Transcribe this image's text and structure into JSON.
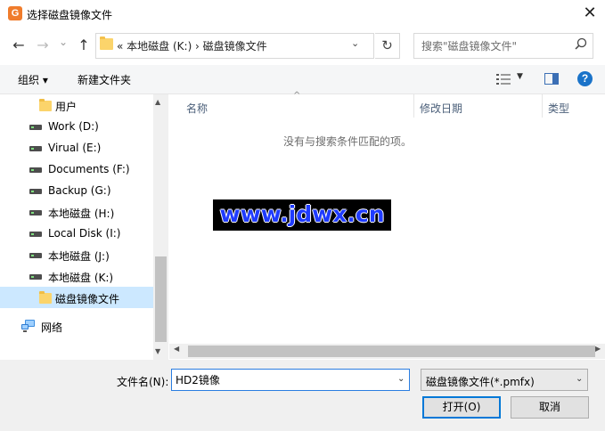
{
  "window": {
    "title": "选择磁盘镜像文件",
    "app_icon_letter": "G",
    "close_glyph": "✕"
  },
  "nav": {
    "back_glyph": "←",
    "forward_glyph": "→",
    "recent_glyph": "⌄",
    "up_glyph": "↑",
    "address_text": "«   本地磁盘 (K:)   ›   磁盘镜像文件",
    "address_chevron": "⌄",
    "refresh_glyph": "↻",
    "search_placeholder": "搜索\"磁盘镜像文件\""
  },
  "toolbar": {
    "organize_label": "组织 ▾",
    "new_folder_label": "新建文件夹",
    "view_chevron": "▼",
    "help_glyph": "?"
  },
  "sidebar": {
    "items": [
      {
        "label": "用户",
        "icon": "folder-icon",
        "selected": false
      },
      {
        "label": "Work (D:)",
        "icon": "drive-icon",
        "selected": false
      },
      {
        "label": "Virual (E:)",
        "icon": "drive-icon",
        "selected": false
      },
      {
        "label": "Documents (F:)",
        "icon": "drive-icon",
        "selected": false
      },
      {
        "label": "Backup (G:)",
        "icon": "drive-icon",
        "selected": false
      },
      {
        "label": "本地磁盘 (H:)",
        "icon": "drive-icon",
        "selected": false
      },
      {
        "label": "Local Disk (I:)",
        "icon": "drive-icon",
        "selected": false
      },
      {
        "label": "本地磁盘 (J:)",
        "icon": "drive-icon",
        "selected": false
      },
      {
        "label": "本地磁盘 (K:)",
        "icon": "drive-icon",
        "selected": false
      },
      {
        "label": "磁盘镜像文件",
        "icon": "folder-icon",
        "selected": true
      },
      {
        "label": "网络",
        "icon": "network-icon",
        "selected": false
      }
    ]
  },
  "main": {
    "columns": [
      "名称",
      "修改日期",
      "类型"
    ],
    "sort_glyph": "^",
    "empty_message": "没有与搜索条件匹配的项。"
  },
  "watermark": {
    "text": "www.jdwx.cn"
  },
  "bottom": {
    "filename_label": "文件名(N):",
    "filename_value": "HD2镜像",
    "filetype_value": "磁盘镜像文件(*.pmfx)",
    "open_label": "打开(O)",
    "cancel_label": "取消"
  },
  "colors": {
    "accent": "#0078d7",
    "selected_bg": "#cce8ff",
    "folder": "#fbd46b"
  }
}
